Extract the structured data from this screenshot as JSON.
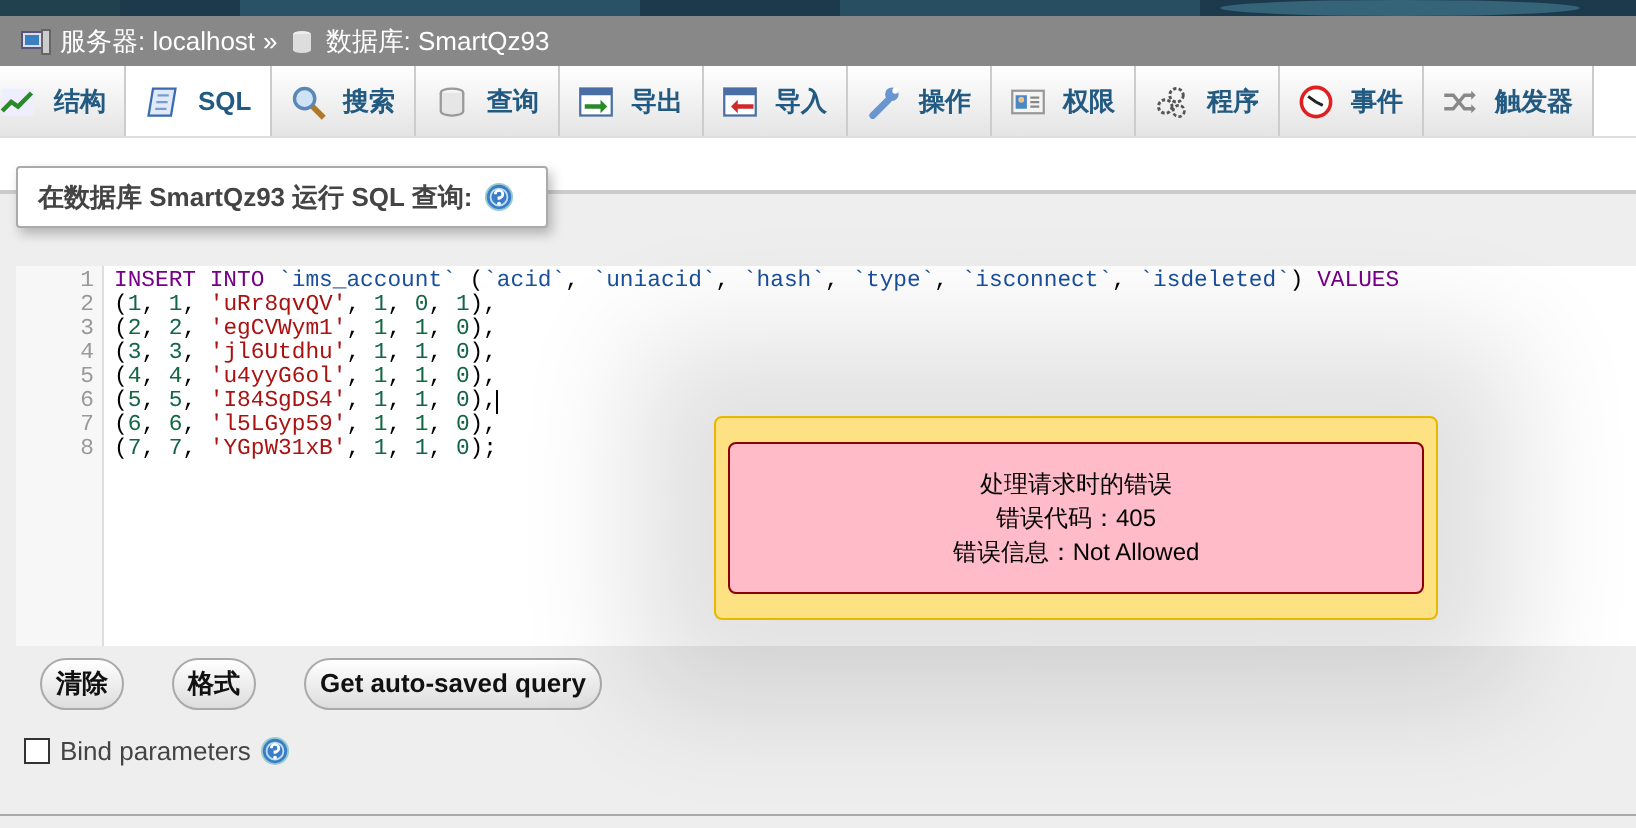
{
  "breadcrumb": {
    "items": [
      {
        "kind": "server",
        "label": "服务器: localhost"
      },
      {
        "kind": "database",
        "label": "数据库: SmartQz93"
      }
    ],
    "separator": "»"
  },
  "tabs": [
    {
      "kind": "structure",
      "label": "结构",
      "selected": false
    },
    {
      "kind": "sql",
      "label": "SQL",
      "selected": true
    },
    {
      "kind": "search",
      "label": "搜索",
      "selected": false
    },
    {
      "kind": "query",
      "label": "查询",
      "selected": false
    },
    {
      "kind": "export",
      "label": "导出",
      "selected": false
    },
    {
      "kind": "import",
      "label": "导入",
      "selected": false
    },
    {
      "kind": "operations",
      "label": "操作",
      "selected": false
    },
    {
      "kind": "privileges",
      "label": "权限",
      "selected": false
    },
    {
      "kind": "routines",
      "label": "程序",
      "selected": false
    },
    {
      "kind": "events",
      "label": "事件",
      "selected": false
    },
    {
      "kind": "triggers",
      "label": "触发器",
      "selected": false
    }
  ],
  "panel": {
    "title": "在数据库 SmartQz93 运行 SQL 查询:"
  },
  "editor": {
    "lines": [
      {
        "number": "1",
        "cursor": false,
        "tokens": [
          {
            "kind": "keyword",
            "text": "INSERT INTO"
          },
          {
            "kind": "name",
            "text": " `ims_account`"
          },
          {
            "kind": "plain",
            "text": " ("
          },
          {
            "kind": "name",
            "text": "`acid`"
          },
          {
            "kind": "plain",
            "text": ", "
          },
          {
            "kind": "name",
            "text": "`uniacid`"
          },
          {
            "kind": "plain",
            "text": ", "
          },
          {
            "kind": "name",
            "text": "`hash`"
          },
          {
            "kind": "plain",
            "text": ", "
          },
          {
            "kind": "name",
            "text": "`type`"
          },
          {
            "kind": "plain",
            "text": ", "
          },
          {
            "kind": "name",
            "text": "`isconnect`"
          },
          {
            "kind": "plain",
            "text": ", "
          },
          {
            "kind": "name",
            "text": "`isdeleted`"
          },
          {
            "kind": "plain",
            "text": ") "
          },
          {
            "kind": "keyword",
            "text": "VALUES"
          }
        ]
      },
      {
        "number": "2",
        "cursor": false,
        "tokens": [
          {
            "kind": "plain",
            "text": "("
          },
          {
            "kind": "number",
            "text": "1"
          },
          {
            "kind": "plain",
            "text": ", "
          },
          {
            "kind": "number",
            "text": "1"
          },
          {
            "kind": "plain",
            "text": ", "
          },
          {
            "kind": "string",
            "text": "'uRr8qvQV'"
          },
          {
            "kind": "plain",
            "text": ", "
          },
          {
            "kind": "number",
            "text": "1"
          },
          {
            "kind": "plain",
            "text": ", "
          },
          {
            "kind": "number",
            "text": "0"
          },
          {
            "kind": "plain",
            "text": ", "
          },
          {
            "kind": "number",
            "text": "1"
          },
          {
            "kind": "plain",
            "text": "),"
          }
        ]
      },
      {
        "number": "3",
        "cursor": false,
        "tokens": [
          {
            "kind": "plain",
            "text": "("
          },
          {
            "kind": "number",
            "text": "2"
          },
          {
            "kind": "plain",
            "text": ", "
          },
          {
            "kind": "number",
            "text": "2"
          },
          {
            "kind": "plain",
            "text": ", "
          },
          {
            "kind": "string",
            "text": "'egCVWym1'"
          },
          {
            "kind": "plain",
            "text": ", "
          },
          {
            "kind": "number",
            "text": "1"
          },
          {
            "kind": "plain",
            "text": ", "
          },
          {
            "kind": "number",
            "text": "1"
          },
          {
            "kind": "plain",
            "text": ", "
          },
          {
            "kind": "number",
            "text": "0"
          },
          {
            "kind": "plain",
            "text": "),"
          }
        ]
      },
      {
        "number": "4",
        "cursor": false,
        "tokens": [
          {
            "kind": "plain",
            "text": "("
          },
          {
            "kind": "number",
            "text": "3"
          },
          {
            "kind": "plain",
            "text": ", "
          },
          {
            "kind": "number",
            "text": "3"
          },
          {
            "kind": "plain",
            "text": ", "
          },
          {
            "kind": "string",
            "text": "'jl6Utdhu'"
          },
          {
            "kind": "plain",
            "text": ", "
          },
          {
            "kind": "number",
            "text": "1"
          },
          {
            "kind": "plain",
            "text": ", "
          },
          {
            "kind": "number",
            "text": "1"
          },
          {
            "kind": "plain",
            "text": ", "
          },
          {
            "kind": "number",
            "text": "0"
          },
          {
            "kind": "plain",
            "text": "),"
          }
        ]
      },
      {
        "number": "5",
        "cursor": false,
        "tokens": [
          {
            "kind": "plain",
            "text": "("
          },
          {
            "kind": "number",
            "text": "4"
          },
          {
            "kind": "plain",
            "text": ", "
          },
          {
            "kind": "number",
            "text": "4"
          },
          {
            "kind": "plain",
            "text": ", "
          },
          {
            "kind": "string",
            "text": "'u4yyG6ol'"
          },
          {
            "kind": "plain",
            "text": ", "
          },
          {
            "kind": "number",
            "text": "1"
          },
          {
            "kind": "plain",
            "text": ", "
          },
          {
            "kind": "number",
            "text": "1"
          },
          {
            "kind": "plain",
            "text": ", "
          },
          {
            "kind": "number",
            "text": "0"
          },
          {
            "kind": "plain",
            "text": "),"
          }
        ]
      },
      {
        "number": "6",
        "cursor": true,
        "tokens": [
          {
            "kind": "plain",
            "text": "("
          },
          {
            "kind": "number",
            "text": "5"
          },
          {
            "kind": "plain",
            "text": ", "
          },
          {
            "kind": "number",
            "text": "5"
          },
          {
            "kind": "plain",
            "text": ", "
          },
          {
            "kind": "string",
            "text": "'I84SgDS4'"
          },
          {
            "kind": "plain",
            "text": ", "
          },
          {
            "kind": "number",
            "text": "1"
          },
          {
            "kind": "plain",
            "text": ", "
          },
          {
            "kind": "number",
            "text": "1"
          },
          {
            "kind": "plain",
            "text": ", "
          },
          {
            "kind": "number",
            "text": "0"
          },
          {
            "kind": "plain",
            "text": "),"
          }
        ]
      },
      {
        "number": "7",
        "cursor": false,
        "tokens": [
          {
            "kind": "plain",
            "text": "("
          },
          {
            "kind": "number",
            "text": "6"
          },
          {
            "kind": "plain",
            "text": ", "
          },
          {
            "kind": "number",
            "text": "6"
          },
          {
            "kind": "plain",
            "text": ", "
          },
          {
            "kind": "string",
            "text": "'l5LGyp59'"
          },
          {
            "kind": "plain",
            "text": ", "
          },
          {
            "kind": "number",
            "text": "1"
          },
          {
            "kind": "plain",
            "text": ", "
          },
          {
            "kind": "number",
            "text": "1"
          },
          {
            "kind": "plain",
            "text": ", "
          },
          {
            "kind": "number",
            "text": "0"
          },
          {
            "kind": "plain",
            "text": "),"
          }
        ]
      },
      {
        "number": "8",
        "cursor": false,
        "tokens": [
          {
            "kind": "plain",
            "text": "("
          },
          {
            "kind": "number",
            "text": "7"
          },
          {
            "kind": "plain",
            "text": ", "
          },
          {
            "kind": "number",
            "text": "7"
          },
          {
            "kind": "plain",
            "text": ", "
          },
          {
            "kind": "string",
            "text": "'YGpW31xB'"
          },
          {
            "kind": "plain",
            "text": ", "
          },
          {
            "kind": "number",
            "text": "1"
          },
          {
            "kind": "plain",
            "text": ", "
          },
          {
            "kind": "number",
            "text": "1"
          },
          {
            "kind": "plain",
            "text": ", "
          },
          {
            "kind": "number",
            "text": "0"
          },
          {
            "kind": "plain",
            "text": ");"
          }
        ]
      }
    ]
  },
  "buttons": [
    "清除",
    "格式",
    "Get auto-saved query"
  ],
  "bind_parameters": {
    "label": "Bind parameters",
    "checked": false
  },
  "error_popup": {
    "title": "处理请求时的错误",
    "lines": [
      "错误代码：405",
      "错误信息：Not Allowed"
    ]
  }
}
